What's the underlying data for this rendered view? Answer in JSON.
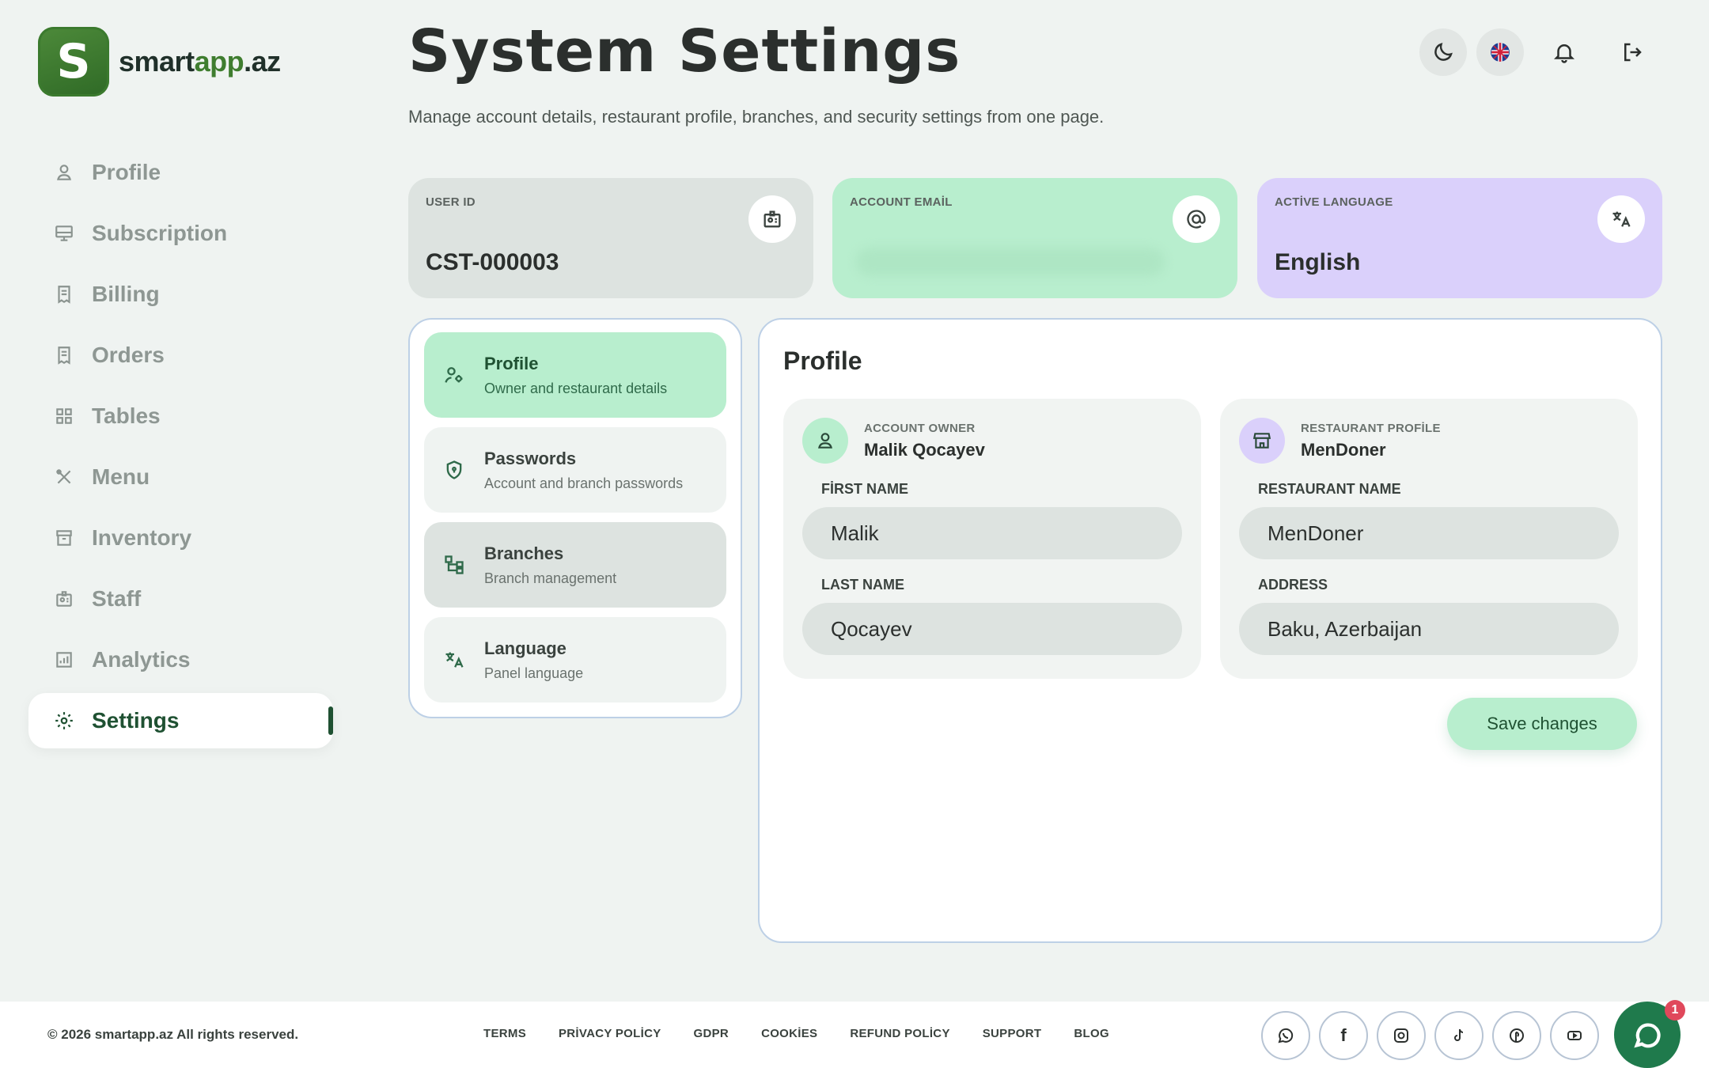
{
  "brand": {
    "logo_letter": "S",
    "name_part1": "smart",
    "name_part2": "app",
    "name_part3": ".az"
  },
  "sidebar": {
    "items": [
      {
        "label": "Profile",
        "icon": "user-icon"
      },
      {
        "label": "Subscription",
        "icon": "monitor-icon"
      },
      {
        "label": "Billing",
        "icon": "receipt-icon"
      },
      {
        "label": "Orders",
        "icon": "receipt-icon"
      },
      {
        "label": "Tables",
        "icon": "grid-icon"
      },
      {
        "label": "Menu",
        "icon": "utensils-icon"
      },
      {
        "label": "Inventory",
        "icon": "archive-icon"
      },
      {
        "label": "Staff",
        "icon": "badge-icon"
      },
      {
        "label": "Analytics",
        "icon": "chart-icon"
      },
      {
        "label": "Settings",
        "icon": "gear-icon",
        "active": true
      }
    ]
  },
  "header": {
    "title": "System Settings",
    "subtitle": "Manage account details, restaurant profile, branches, and security settings from one page."
  },
  "stats": {
    "user_id": {
      "label": "USER ID",
      "value": "CST-000003"
    },
    "email": {
      "label": "ACCOUNT EMAİL",
      "value": ""
    },
    "language": {
      "label": "ACTİVE LANGUAGE",
      "value": "English"
    }
  },
  "tabs": [
    {
      "title": "Profile",
      "subtitle": "Owner and restaurant details"
    },
    {
      "title": "Passwords",
      "subtitle": "Account and branch passwords"
    },
    {
      "title": "Branches",
      "subtitle": "Branch management"
    },
    {
      "title": "Language",
      "subtitle": "Panel language"
    }
  ],
  "content": {
    "title": "Profile",
    "owner": {
      "caption": "ACCOUNT OWNER",
      "name": "Malik Qocayev",
      "first_name_label": "FİRST NAME",
      "first_name": "Malik",
      "last_name_label": "LAST NAME",
      "last_name": "Qocayev"
    },
    "restaurant": {
      "caption": "RESTAURANT PROFİLE",
      "name": "MenDoner",
      "restaurant_name_label": "RESTAURANT NAME",
      "restaurant_name": "MenDoner",
      "address_label": "ADDRESS",
      "address": "Baku, Azerbaijan"
    },
    "save_label": "Save changes"
  },
  "footer": {
    "copyright": "© 2026 smartapp.az All rights reserved.",
    "links": [
      "TERMS",
      "PRİVACY POLİCY",
      "GDPR",
      "COOKİES",
      "REFUND POLİCY",
      "SUPPORT",
      "BLOG"
    ],
    "socials": [
      "whatsapp-icon",
      "facebook-icon",
      "instagram-icon",
      "tiktok-icon",
      "pinterest-icon",
      "youtube-icon"
    ],
    "chat_badge": "1"
  },
  "colors": {
    "accent_green": "#b8eece",
    "accent_purple": "#dad0fb",
    "brand_dark": "#1f5132",
    "badge_red": "#e0485b"
  }
}
